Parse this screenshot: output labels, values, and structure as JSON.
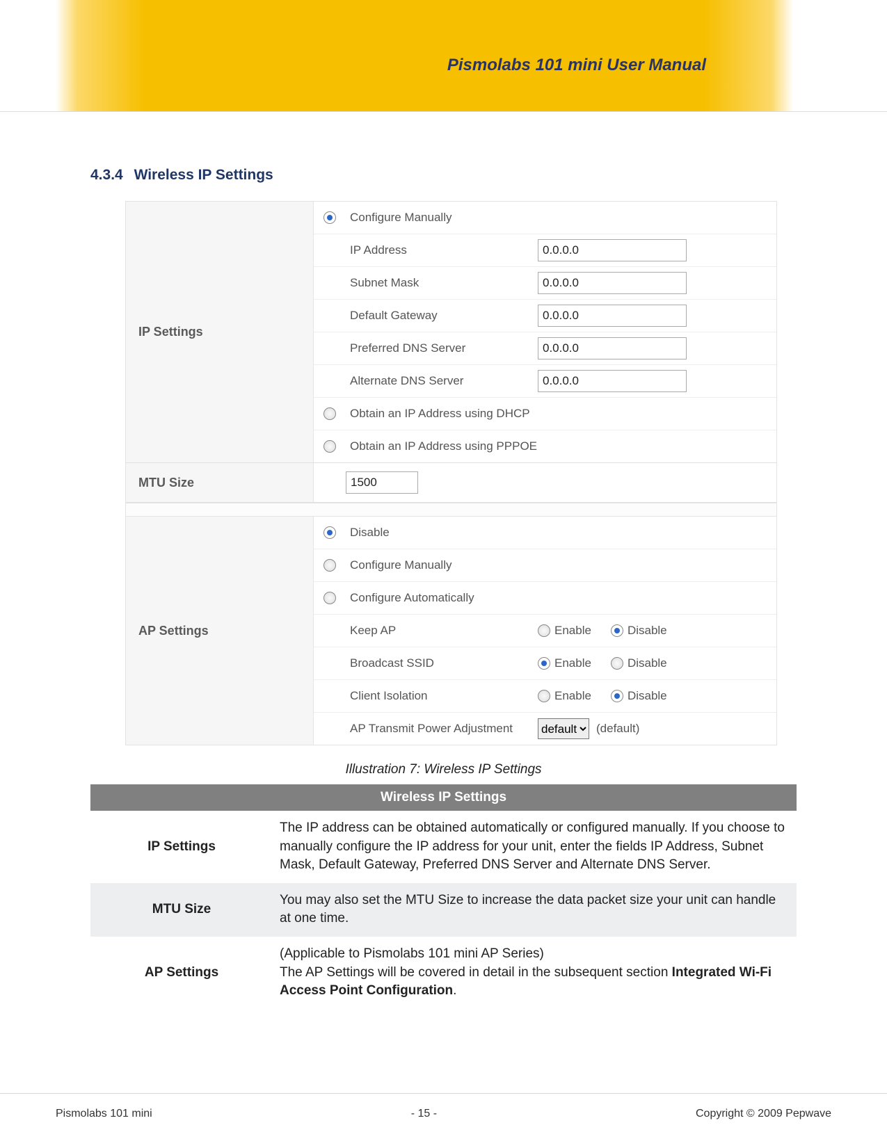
{
  "doc_title": "Pismolabs 101 mini User Manual",
  "section_number": "4.3.4",
  "section_title": "Wireless IP Settings",
  "ip_settings_label": "IP Settings",
  "mtu_label": "MTU Size",
  "ap_settings_label": "AP Settings",
  "form": {
    "configure_manually": "Configure Manually",
    "ip_address_label": "IP Address",
    "ip_address_value": "0.0.0.0",
    "subnet_label": "Subnet Mask",
    "subnet_value": "0.0.0.0",
    "gateway_label": "Default Gateway",
    "gateway_value": "0.0.0.0",
    "pdns_label": "Preferred DNS Server",
    "pdns_value": "0.0.0.0",
    "adns_label": "Alternate DNS Server",
    "adns_value": "0.0.0.0",
    "obtain_dhcp": "Obtain an IP Address using DHCP",
    "obtain_pppoe": "Obtain an IP Address using PPPOE",
    "mtu_value": "1500",
    "ap_disable": "Disable",
    "ap_conf_manual": "Configure Manually",
    "ap_conf_auto": "Configure Automatically",
    "keep_ap": "Keep AP",
    "broadcast_ssid": "Broadcast SSID",
    "client_iso": "Client Isolation",
    "ap_tx": "AP Transmit Power Adjustment",
    "enable": "Enable",
    "disable": "Disable",
    "tx_select": "default",
    "tx_hint": "(default)"
  },
  "caption": "Illustration 7: Wireless IP Settings",
  "desc": {
    "header": "Wireless IP Settings",
    "ip_label": "IP Settings",
    "ip_text": "The IP address can be obtained automatically or configured manually. If you choose to manually configure the IP address for your unit, enter the fields IP Address, Subnet Mask, Default Gateway, Preferred DNS Server and Alternate DNS Server.",
    "mtu_label": "MTU Size",
    "mtu_text": "You may also set the MTU Size to increase the data packet size your unit can handle at one time.",
    "ap_label": "AP Settings",
    "ap_text_1": "(Applicable to Pismolabs 101 mini AP Series)",
    "ap_text_2a": "The AP Settings will be covered in detail in the subsequent section ",
    "ap_text_2b": "Integrated Wi-Fi Access Point Configuration",
    "ap_text_2c": "."
  },
  "footer": {
    "left": "Pismolabs 101 mini",
    "center": "- 15 -",
    "right": "Copyright © 2009 Pepwave"
  }
}
